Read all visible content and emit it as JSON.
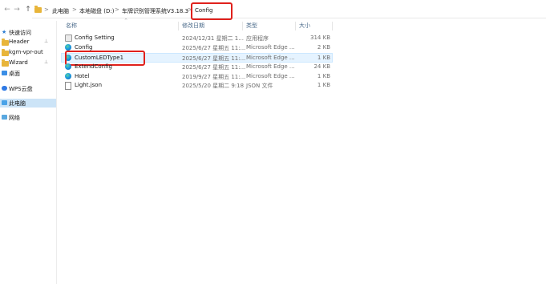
{
  "nav": {
    "back": "←",
    "forward": "→",
    "up": "↑"
  },
  "breadcrumbs": [
    "此电脑",
    "本地磁盘 (D:)",
    "车牌识别管理系统V3.18.3",
    "Config"
  ],
  "breadcrumb_separator": ">",
  "columns": {
    "name": "名称",
    "modified": "修改日期",
    "type": "类型",
    "size": "大小"
  },
  "sidebar": {
    "quick_access": "快速访问",
    "items": [
      {
        "label": "Header",
        "icon": "folder-icon"
      },
      {
        "label": "kgm-vpr-out",
        "icon": "folder-icon"
      },
      {
        "label": "Wizard",
        "icon": "folder-icon"
      },
      {
        "label": "桌面",
        "icon": "desktop-icon"
      },
      {
        "label": "WPS云盘",
        "icon": "cloud-icon"
      },
      {
        "label": "此电脑",
        "icon": "computer-icon"
      },
      {
        "label": "网络",
        "icon": "network-icon"
      }
    ]
  },
  "files": [
    {
      "name": "Config Setting",
      "modified": "2024/12/31 星期二 1...",
      "type": "应用程序",
      "size": "314 KB",
      "icon": "app-icon"
    },
    {
      "name": "Config",
      "modified": "2025/6/27 星期五 11:...",
      "type": "Microsoft Edge ...",
      "size": "2 KB",
      "icon": "edge-icon"
    },
    {
      "name": "CustomLEDType1",
      "modified": "2025/6/27 星期五 11:...",
      "type": "Microsoft Edge ...",
      "size": "1 KB",
      "icon": "edge-icon"
    },
    {
      "name": "ExtendConfig",
      "modified": "2025/6/27 星期五 11:...",
      "type": "Microsoft Edge ...",
      "size": "24 KB",
      "icon": "edge-icon"
    },
    {
      "name": "Hotel",
      "modified": "2019/9/27 星期五 11:...",
      "type": "Microsoft Edge ...",
      "size": "1 KB",
      "icon": "edge-icon"
    },
    {
      "name": "Light.json",
      "modified": "2025/5/20 星期二 9:18",
      "type": "JSON 文件",
      "size": "1 KB",
      "icon": "json-icon"
    }
  ],
  "colors": {
    "highlight": "#e0211c",
    "selected": "#cce4f7",
    "folder": "#e8b53a"
  }
}
